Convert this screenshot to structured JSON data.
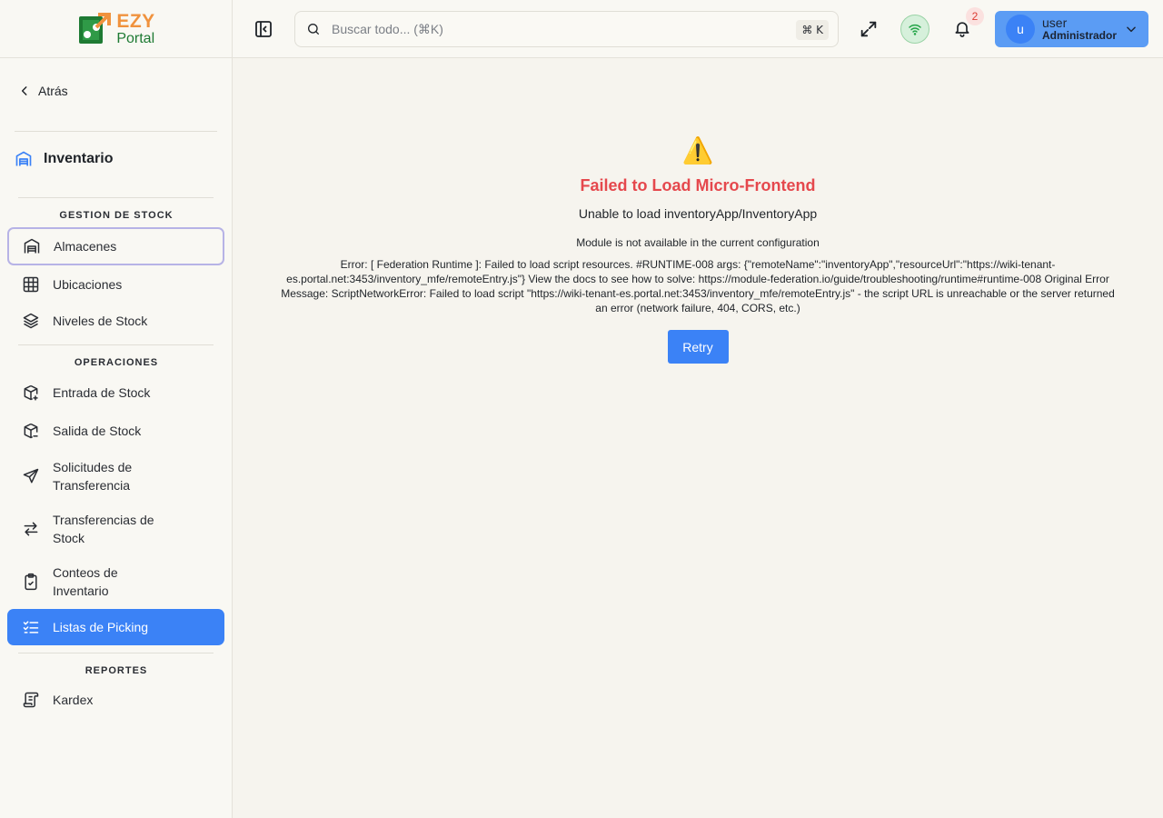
{
  "brand": {
    "name_top": "EZY",
    "name_bottom": "Portal"
  },
  "sidebar": {
    "back_label": "Atrás",
    "module_title": "Inventario",
    "sections": {
      "stock": "GESTION DE STOCK",
      "ops": "OPERACIONES",
      "reports": "REPORTES"
    },
    "items": {
      "almacenes": "Almacenes",
      "ubicaciones": "Ubicaciones",
      "niveles": "Niveles de Stock",
      "entrada": "Entrada de Stock",
      "salida": "Salida de Stock",
      "solicitudes": "Solicitudes de Transferencia",
      "transferencias": "Transferencias de Stock",
      "conteos": "Conteos de Inventario",
      "picking": "Listas de Picking",
      "kardex": "Kardex"
    }
  },
  "header": {
    "search_placeholder": "Buscar todo... (⌘K)",
    "shortcut": "⌘ K",
    "notification_count": "2",
    "user": {
      "initial": "u",
      "name": "user",
      "role": "Administrador"
    }
  },
  "error": {
    "icon": "⚠️",
    "title": "Failed to Load Micro-Frontend",
    "subtitle": "Unable to load inventoryApp/InventoryApp",
    "detail": "Module is not available in the current configuration",
    "message": "Error: [ Federation Runtime ]: Failed to load script resources. #RUNTIME-008 args: {\"remoteName\":\"inventoryApp\",\"resourceUrl\":\"https://wiki-tenant-es.portal.net:3453/inventory_mfe/remoteEntry.js\"} View the docs to see how to solve: https://module-federation.io/guide/troubleshooting/runtime#runtime-008 Original Error Message: ScriptNetworkError: Failed to load script \"https://wiki-tenant-es.portal.net:3453/inventory_mfe/remoteEntry.js\" - the script URL is unreachable or the server returned an error (network failure, 404, CORS, etc.)",
    "retry_label": "Retry"
  },
  "colors": {
    "accent": "#3b82f6",
    "error": "#e5484d",
    "brand_orange": "#f0923d",
    "brand_green": "#1e7a33"
  }
}
